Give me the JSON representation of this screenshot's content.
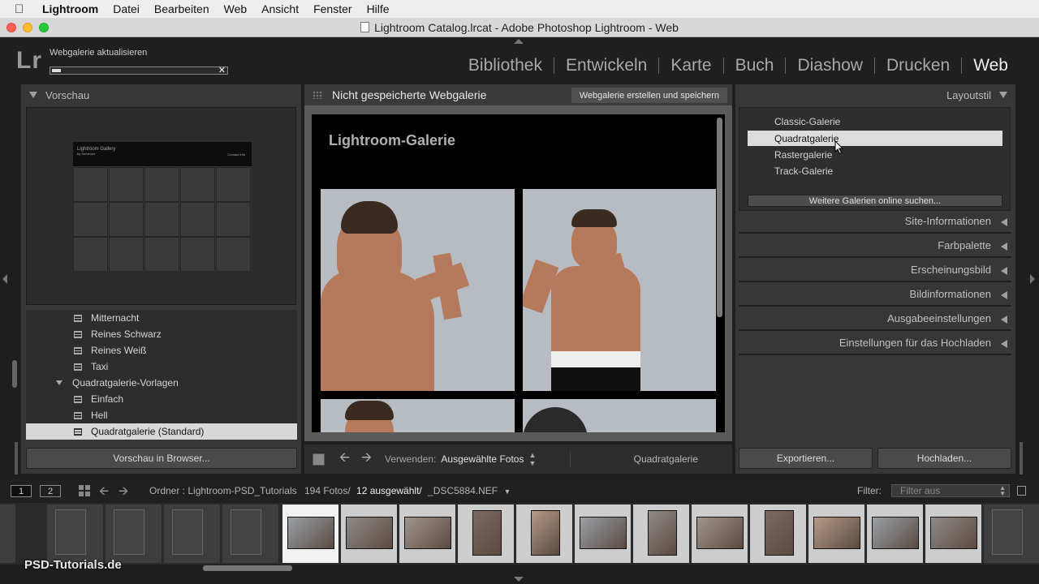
{
  "menubar": {
    "app": "Lightroom",
    "items": [
      "Datei",
      "Bearbeiten",
      "Web",
      "Ansicht",
      "Fenster",
      "Hilfe"
    ]
  },
  "window": {
    "title": "Lightroom Catalog.lrcat - Adobe Photoshop Lightroom - Web"
  },
  "identity": {
    "logo": "Lr",
    "progress_label": "Webgalerie aktualisieren",
    "progress_fraction": 0.05,
    "progress_close": "✕"
  },
  "modules": {
    "items": [
      "Bibliothek",
      "Entwickeln",
      "Karte",
      "Buch",
      "Diashow",
      "Drucken",
      "Web"
    ],
    "active": "Web"
  },
  "left_panel": {
    "preview_header": "Vorschau",
    "preview_thumb_title": "Lightroom Gallery",
    "preview_thumb_sub": "by Someone",
    "preview_thumb_contact": "Contact Info",
    "templates": [
      {
        "label": "Mitternacht",
        "type": "item"
      },
      {
        "label": "Reines Schwarz",
        "type": "item"
      },
      {
        "label": "Reines Weiß",
        "type": "item"
      },
      {
        "label": "Taxi",
        "type": "item"
      },
      {
        "label": "Quadratgalerie-Vorlagen",
        "type": "folder"
      },
      {
        "label": "Einfach",
        "type": "item"
      },
      {
        "label": "Hell",
        "type": "item"
      },
      {
        "label": "Quadratgalerie (Standard)",
        "type": "item",
        "selected": true
      }
    ],
    "preview_browser_button": "Vorschau in Browser..."
  },
  "center": {
    "header_title": "Nicht gespeicherte Webgalerie",
    "save_button": "Webgalerie erstellen und speichern",
    "gallery_title": "Lightroom-Galerie",
    "toolbar": {
      "use_label": "Verwenden:",
      "use_value": "Ausgewählte Fotos",
      "layout_name": "Quadratgalerie"
    }
  },
  "right_panel": {
    "layout_header": "Layoutstil",
    "layouts": [
      "Classic-Galerie",
      "Quadratgalerie",
      "Rastergalerie",
      "Track-Galerie"
    ],
    "selected_layout": "Quadratgalerie",
    "online_button": "Weitere Galerien online suchen...",
    "sections": [
      "Site-Informationen",
      "Farbpalette",
      "Erscheinungsbild",
      "Bildinformationen",
      "Ausgabeeinstellungen",
      "Einstellungen für das Hochladen"
    ],
    "export_button": "Exportieren...",
    "upload_button": "Hochladen..."
  },
  "filmstrip_bar": {
    "screen1": "1",
    "screen2": "2",
    "folder_prefix": "Ordner : Lightroom-PSD_Tutorials",
    "photo_count": "194 Fotos/",
    "selected_count": "12 ausgewählt/",
    "current_file": "_DSC5884.NEF",
    "filter_label": "Filter:",
    "filter_value": "Filter aus"
  },
  "watermark": "PSD-Tutorials.de",
  "colors": {
    "panel_bg": "#373737",
    "app_bg": "#1e1e1e",
    "selected_row": "#d8d8d8",
    "active_module": "#f0f0f0"
  }
}
